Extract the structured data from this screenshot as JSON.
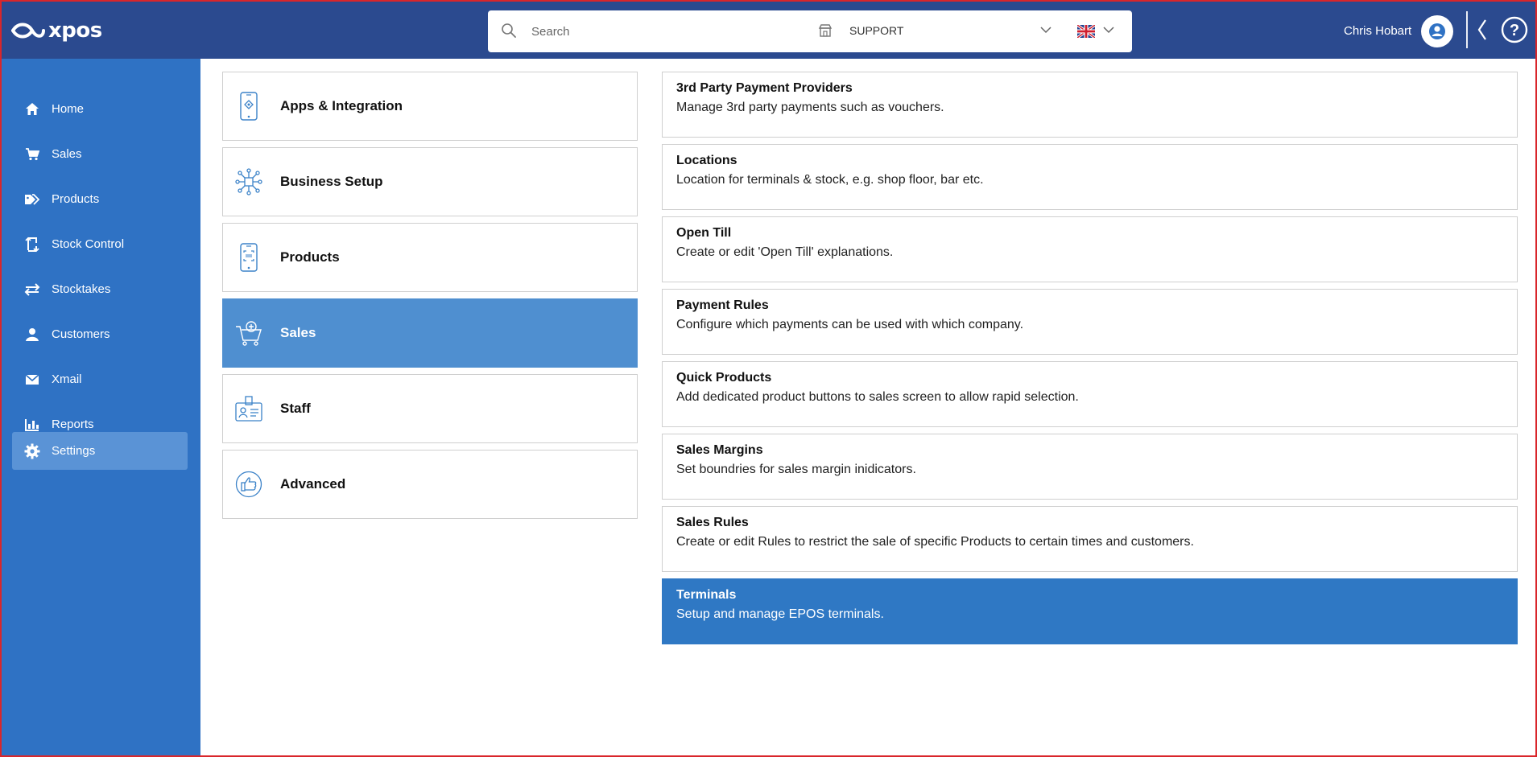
{
  "app": {
    "brand": "xpos"
  },
  "search": {
    "placeholder": "Search"
  },
  "store": {
    "name": "SUPPORT"
  },
  "user": {
    "name": "Chris Hobart"
  },
  "colors": {
    "topbar": "#2b4a8f",
    "sidebar": "#2f72c4",
    "sidebar_active": "#5a93d6",
    "category_active": "#4f8fd0",
    "option_active": "#2f78c4"
  },
  "sidebar": {
    "items": [
      {
        "label": "Home",
        "icon": "home-icon"
      },
      {
        "label": "Sales",
        "icon": "cart-icon"
      },
      {
        "label": "Products",
        "icon": "tag-icon"
      },
      {
        "label": "Stock Control",
        "icon": "stock-icon"
      },
      {
        "label": "Stocktakes",
        "icon": "transfer-icon"
      },
      {
        "label": "Customers",
        "icon": "user-icon"
      },
      {
        "label": "Xmail",
        "icon": "mail-icon"
      },
      {
        "label": "Reports",
        "icon": "bar-chart-icon"
      },
      {
        "label": "Settings",
        "icon": "gear-icon",
        "active": true
      }
    ]
  },
  "categories": [
    {
      "label": "Apps & Integration",
      "icon": "phone-app-icon"
    },
    {
      "label": "Business Setup",
      "icon": "network-icon"
    },
    {
      "label": "Products",
      "icon": "phone-scan-icon"
    },
    {
      "label": "Sales",
      "icon": "cart-add-icon",
      "active": true
    },
    {
      "label": "Staff",
      "icon": "id-badge-icon"
    },
    {
      "label": "Advanced",
      "icon": "thumbs-up-icon"
    }
  ],
  "options": [
    {
      "title": "3rd Party Payment Providers",
      "desc": "Manage 3rd party payments such as vouchers."
    },
    {
      "title": "Locations",
      "desc": "Location for terminals & stock, e.g. shop floor, bar etc."
    },
    {
      "title": "Open Till",
      "desc": "Create or edit 'Open Till' explanations."
    },
    {
      "title": "Payment Rules",
      "desc": "Configure which payments can be used with which company."
    },
    {
      "title": "Quick Products",
      "desc": "Add dedicated product buttons to sales screen to allow rapid selection."
    },
    {
      "title": "Sales Margins",
      "desc": "Set boundries for sales margin inidicators."
    },
    {
      "title": "Sales Rules",
      "desc": "Create or edit Rules to restrict the sale of specific Products to certain times and customers."
    },
    {
      "title": "Terminals",
      "desc": "Setup and manage EPOS terminals.",
      "active": true
    }
  ]
}
